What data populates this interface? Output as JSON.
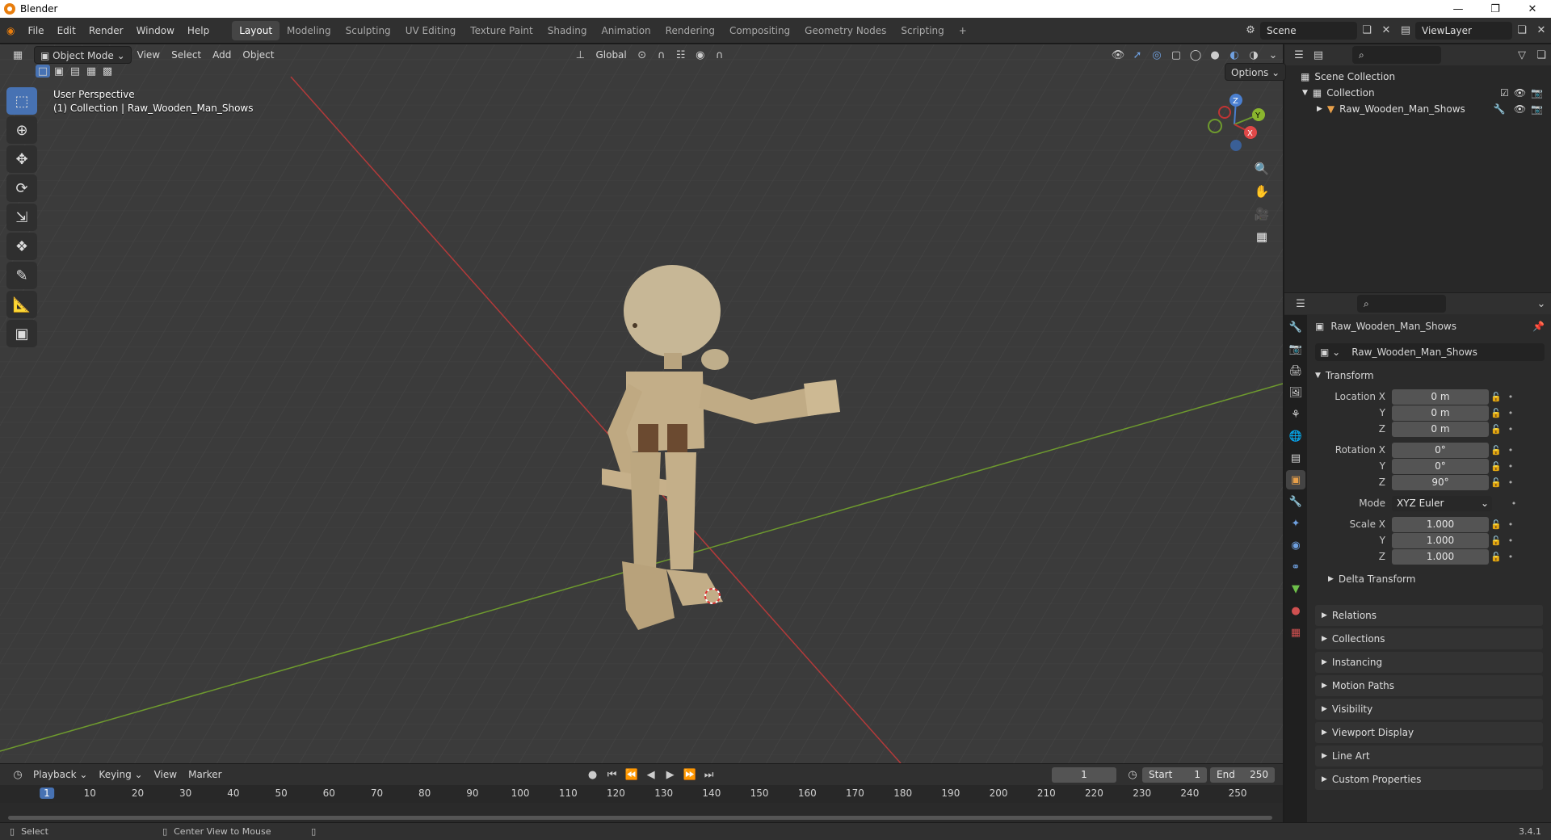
{
  "window": {
    "title": "Blender"
  },
  "menu": {
    "items": [
      "File",
      "Edit",
      "Render",
      "Window",
      "Help"
    ]
  },
  "workspaces": [
    "Layout",
    "Modeling",
    "Sculpting",
    "UV Editing",
    "Texture Paint",
    "Shading",
    "Animation",
    "Rendering",
    "Compositing",
    "Geometry Nodes",
    "Scripting"
  ],
  "active_workspace": "Layout",
  "scene": {
    "name": "Scene"
  },
  "view_layer": {
    "name": "ViewLayer"
  },
  "viewport": {
    "mode": "Object Mode",
    "menus": [
      "View",
      "Select",
      "Add",
      "Object"
    ],
    "orientation": "Global",
    "options_label": "Options",
    "perspective_label": "User Perspective",
    "collection_label": "(1) Collection | Raw_Wooden_Man_Shows"
  },
  "gizmo": {
    "x": "X",
    "y": "Y",
    "z": "Z"
  },
  "outliner": {
    "scene_collection": "Scene Collection",
    "collection": "Collection",
    "object": "Raw_Wooden_Man_Shows"
  },
  "properties": {
    "object_name": "Raw_Wooden_Man_Shows",
    "data_name": "Raw_Wooden_Man_Shows",
    "transform_label": "Transform",
    "location_label": "Location X",
    "rotation_label": "Rotation X",
    "scale_label": "Scale X",
    "y_label": "Y",
    "z_label": "Z",
    "mode_label": "Mode",
    "mode_value": "XYZ Euler",
    "location": [
      "0 m",
      "0 m",
      "0 m"
    ],
    "rotation": [
      "0°",
      "0°",
      "90°"
    ],
    "scale": [
      "1.000",
      "1.000",
      "1.000"
    ],
    "delta_label": "Delta Transform",
    "panels": [
      "Relations",
      "Collections",
      "Instancing",
      "Motion Paths",
      "Visibility",
      "Viewport Display",
      "Line Art",
      "Custom Properties"
    ]
  },
  "timeline": {
    "menus": [
      "Playback",
      "Keying",
      "View",
      "Marker"
    ],
    "current_frame": "1",
    "start_label": "Start",
    "start": "1",
    "end_label": "End",
    "end": "250",
    "ticks": [
      "1",
      "10",
      "20",
      "30",
      "40",
      "50",
      "60",
      "70",
      "80",
      "90",
      "100",
      "110",
      "120",
      "130",
      "140",
      "150",
      "160",
      "170",
      "180",
      "190",
      "200",
      "210",
      "220",
      "230",
      "240",
      "250"
    ]
  },
  "status": {
    "select": "Select",
    "center": "Center View to Mouse",
    "version": "3.4.1"
  },
  "colors": {
    "accent": "#4772b3",
    "x_axis": "#c03434",
    "y_axis": "#6e9a2e",
    "wood": "#c8b48e"
  }
}
